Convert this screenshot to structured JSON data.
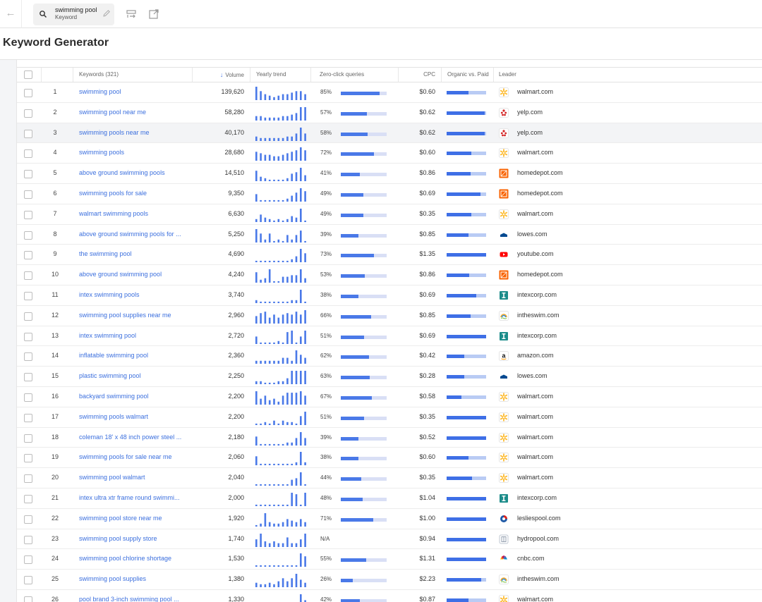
{
  "search": {
    "query": "swimming pool",
    "type": "Keyword"
  },
  "page": {
    "title": "Keyword Generator"
  },
  "columns": {
    "keywords": "Keywords (321)",
    "volume": "Volume",
    "trend": "Yearly trend",
    "zero_click": "Zero-click queries",
    "cpc": "CPC",
    "organic_paid": "Organic vs. Paid",
    "leader": "Leader"
  },
  "colors": {
    "accent": "#4a79e8",
    "organic_light": "#b9cbf4",
    "zero_click_bg": "#d9dff5"
  },
  "rows": [
    {
      "n": "1",
      "kw": "swimming pool",
      "vol": "139,620",
      "zc": "85%",
      "zcv": 85,
      "cpc": "$0.60",
      "org": 55,
      "leader": "walmart.com",
      "icon": "walmart-icon",
      "trend": [
        9,
        6,
        4,
        3,
        2,
        3,
        4,
        4,
        5,
        6,
        6,
        4
      ]
    },
    {
      "n": "2",
      "kw": "swimming pool near me",
      "vol": "58,280",
      "zc": "57%",
      "zcv": 57,
      "cpc": "$0.62",
      "org": 97,
      "leader": "yelp.com",
      "icon": "yelp-icon",
      "trend": [
        3,
        3,
        2,
        2,
        2,
        2,
        3,
        3,
        4,
        5,
        9,
        9
      ]
    },
    {
      "n": "3",
      "kw": "swimming pools near me",
      "vol": "40,170",
      "zc": "58%",
      "zcv": 58,
      "cpc": "$0.62",
      "org": 97,
      "leader": "yelp.com",
      "icon": "yelp-icon",
      "trend": [
        3,
        2,
        2,
        2,
        2,
        2,
        2,
        3,
        3,
        5,
        9,
        5
      ]
    },
    {
      "n": "4",
      "kw": "swimming pools",
      "vol": "28,680",
      "zc": "72%",
      "zcv": 72,
      "cpc": "$0.60",
      "org": 62,
      "leader": "walmart.com",
      "icon": "walmart-icon",
      "trend": [
        6,
        5,
        4,
        4,
        3,
        3,
        4,
        5,
        6,
        7,
        9,
        7
      ]
    },
    {
      "n": "5",
      "kw": "above ground swimming pools",
      "vol": "14,510",
      "zc": "41%",
      "zcv": 41,
      "cpc": "$0.86",
      "org": 60,
      "leader": "homedepot.com",
      "icon": "homedepot-icon",
      "trend": [
        7,
        3,
        2,
        1,
        1,
        1,
        1,
        2,
        5,
        6,
        9,
        4
      ]
    },
    {
      "n": "6",
      "kw": "swimming pools for sale",
      "vol": "9,350",
      "zc": "49%",
      "zcv": 49,
      "cpc": "$0.69",
      "org": 85,
      "leader": "homedepot.com",
      "icon": "homedepot-icon",
      "trend": [
        5,
        1,
        1,
        1,
        1,
        1,
        1,
        2,
        4,
        6,
        9,
        7
      ]
    },
    {
      "n": "7",
      "kw": "walmart swimming pools",
      "vol": "6,630",
      "zc": "49%",
      "zcv": 49,
      "cpc": "$0.35",
      "org": 62,
      "leader": "walmart.com",
      "icon": "walmart-icon",
      "trend": [
        2,
        5,
        3,
        2,
        1,
        2,
        1,
        2,
        4,
        3,
        9,
        1
      ]
    },
    {
      "n": "8",
      "kw": "above ground swimming pools for ...",
      "vol": "5,250",
      "zc": "39%",
      "zcv": 39,
      "cpc": "$0.85",
      "org": 55,
      "leader": "lowes.com",
      "icon": "lowes-icon",
      "trend": [
        9,
        6,
        2,
        6,
        1,
        2,
        1,
        5,
        2,
        5,
        8,
        1
      ]
    },
    {
      "n": "9",
      "kw": "the swimming pool",
      "vol": "4,690",
      "zc": "73%",
      "zcv": 73,
      "cpc": "$1.35",
      "org": 100,
      "leader": "youtube.com",
      "icon": "youtube-icon",
      "trend": [
        1,
        1,
        1,
        1,
        1,
        1,
        1,
        1,
        2,
        4,
        9,
        6
      ]
    },
    {
      "n": "10",
      "kw": "above ground swimming pool",
      "vol": "4,240",
      "zc": "53%",
      "zcv": 53,
      "cpc": "$0.86",
      "org": 57,
      "leader": "homedepot.com",
      "icon": "homedepot-icon",
      "trend": [
        7,
        2,
        3,
        9,
        1,
        1,
        4,
        4,
        5,
        5,
        9,
        3
      ]
    },
    {
      "n": "11",
      "kw": "intex swimming pools",
      "vol": "3,740",
      "zc": "38%",
      "zcv": 38,
      "cpc": "$0.69",
      "org": 75,
      "leader": "intexcorp.com",
      "icon": "intex-icon",
      "trend": [
        2,
        1,
        1,
        1,
        1,
        1,
        1,
        1,
        2,
        2,
        9,
        1
      ]
    },
    {
      "n": "12",
      "kw": "swimming pool supplies near me",
      "vol": "2,960",
      "zc": "66%",
      "zcv": 66,
      "cpc": "$0.85",
      "org": 60,
      "leader": "intheswim.com",
      "icon": "intheswim-icon",
      "trend": [
        5,
        7,
        8,
        4,
        6,
        4,
        6,
        7,
        6,
        8,
        6,
        9
      ]
    },
    {
      "n": "13",
      "kw": "intex swimming pool",
      "vol": "2,720",
      "zc": "51%",
      "zcv": 51,
      "cpc": "$0.69",
      "org": 100,
      "leader": "intexcorp.com",
      "icon": "intex-icon",
      "trend": [
        5,
        1,
        1,
        1,
        1,
        2,
        1,
        8,
        9,
        1,
        5,
        9
      ]
    },
    {
      "n": "14",
      "kw": "inflatable swimming pool",
      "vol": "2,360",
      "zc": "62%",
      "zcv": 62,
      "cpc": "$0.42",
      "org": 45,
      "leader": "amazon.com",
      "icon": "amazon-icon",
      "trend": [
        2,
        2,
        2,
        2,
        2,
        2,
        4,
        4,
        2,
        9,
        6,
        4
      ]
    },
    {
      "n": "15",
      "kw": "plastic swimming pool",
      "vol": "2,250",
      "zc": "63%",
      "zcv": 63,
      "cpc": "$0.28",
      "org": 45,
      "leader": "lowes.com",
      "icon": "lowes-icon",
      "trend": [
        2,
        2,
        1,
        1,
        1,
        2,
        2,
        4,
        9,
        9,
        9,
        9
      ]
    },
    {
      "n": "16",
      "kw": "backyard swimming pool",
      "vol": "2,200",
      "zc": "67%",
      "zcv": 67,
      "cpc": "$0.58",
      "org": 38,
      "leader": "walmart.com",
      "icon": "walmart-icon",
      "trend": [
        9,
        4,
        6,
        3,
        4,
        2,
        6,
        8,
        8,
        8,
        9,
        6
      ]
    },
    {
      "n": "17",
      "kw": "swimming pools walmart",
      "vol": "2,200",
      "zc": "51%",
      "zcv": 51,
      "cpc": "$0.35",
      "org": 100,
      "leader": "walmart.com",
      "icon": "walmart-icon",
      "trend": [
        1,
        1,
        2,
        1,
        3,
        1,
        3,
        2,
        2,
        1,
        6,
        9
      ]
    },
    {
      "n": "18",
      "kw": "coleman 18' x 48 inch power steel ...",
      "vol": "2,180",
      "zc": "39%",
      "zcv": 39,
      "cpc": "$0.52",
      "org": 100,
      "leader": "walmart.com",
      "icon": "walmart-icon",
      "trend": [
        6,
        1,
        1,
        1,
        1,
        1,
        1,
        2,
        2,
        5,
        9,
        5
      ]
    },
    {
      "n": "19",
      "kw": "swimming pools for sale near me",
      "vol": "2,060",
      "zc": "38%",
      "zcv": 38,
      "cpc": "$0.60",
      "org": 55,
      "leader": "walmart.com",
      "icon": "walmart-icon",
      "trend": [
        6,
        1,
        1,
        1,
        1,
        1,
        1,
        1,
        1,
        2,
        9,
        2
      ]
    },
    {
      "n": "20",
      "kw": "swimming pool walmart",
      "vol": "2,040",
      "zc": "44%",
      "zcv": 44,
      "cpc": "$0.35",
      "org": 65,
      "leader": "walmart.com",
      "icon": "walmart-icon",
      "trend": [
        1,
        1,
        1,
        1,
        1,
        1,
        1,
        1,
        4,
        5,
        9,
        1
      ]
    },
    {
      "n": "21",
      "kw": "intex ultra xtr frame round swimmi...",
      "vol": "2,000",
      "zc": "48%",
      "zcv": 48,
      "cpc": "$1.04",
      "org": 100,
      "leader": "intexcorp.com",
      "icon": "intex-icon",
      "trend": [
        1,
        1,
        1,
        1,
        1,
        1,
        1,
        1,
        9,
        8,
        1,
        9
      ]
    },
    {
      "n": "22",
      "kw": "swimming pool store near me",
      "vol": "1,920",
      "zc": "71%",
      "zcv": 71,
      "cpc": "$1.00",
      "org": 100,
      "leader": "lesliespool.com",
      "icon": "lesliespool-icon",
      "trend": [
        1,
        2,
        9,
        3,
        2,
        2,
        3,
        5,
        4,
        3,
        5,
        3
      ]
    },
    {
      "n": "23",
      "kw": "swimming pool supply store",
      "vol": "1,740",
      "zc": "N/A",
      "zcv": 0,
      "cpc": "$0.94",
      "org": 100,
      "leader": "hydropool.com",
      "icon": "hydropool-icon",
      "trend": [
        4,
        7,
        3,
        2,
        3,
        2,
        2,
        5,
        2,
        2,
        4,
        7
      ]
    },
    {
      "n": "24",
      "kw": "swimming pool chlorine shortage",
      "vol": "1,530",
      "zc": "55%",
      "zcv": 55,
      "cpc": "$1.31",
      "org": 100,
      "leader": "cnbc.com",
      "icon": "cnbc-icon",
      "trend": [
        1,
        1,
        1,
        1,
        1,
        1,
        1,
        1,
        1,
        1,
        9,
        7
      ]
    },
    {
      "n": "25",
      "kw": "swimming pool supplies",
      "vol": "1,380",
      "zc": "26%",
      "zcv": 26,
      "cpc": "$2.23",
      "org": 88,
      "leader": "intheswim.com",
      "icon": "intheswim-icon",
      "trend": [
        3,
        2,
        2,
        3,
        2,
        4,
        6,
        4,
        6,
        9,
        5,
        3
      ]
    },
    {
      "n": "26",
      "kw": "pool brand 3-inch swimming pool ...",
      "vol": "1,330",
      "zc": "42%",
      "zcv": 42,
      "cpc": "$0.87",
      "org": 55,
      "leader": "walmart.com",
      "icon": "walmart-icon",
      "trend": [
        1,
        1,
        1,
        1,
        1,
        1,
        1,
        1,
        1,
        1,
        9,
        5
      ]
    }
  ]
}
